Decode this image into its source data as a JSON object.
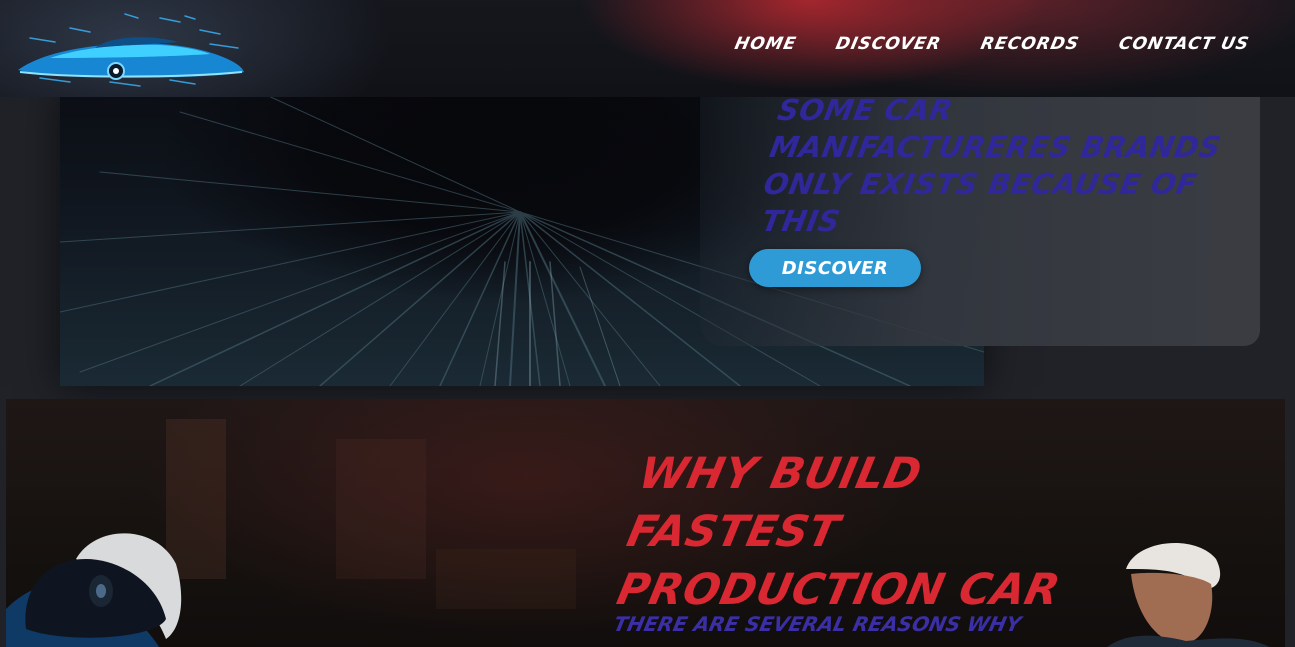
{
  "nav": {
    "items": [
      {
        "label": "HOME"
      },
      {
        "label": "DISCOVER"
      },
      {
        "label": "RECORDS"
      },
      {
        "label": "CONTACT US"
      }
    ]
  },
  "hero": {
    "title_lines": [
      "SOME CAR",
      "MANIFACTURERES BRANDS",
      "ONLY EXISTS BECAUSE OF",
      "THIS"
    ],
    "button_label": "DISCOVER"
  },
  "section2": {
    "title_lines": [
      "WHY BUILD",
      "FASTEST",
      "PRODUCTION CAR"
    ],
    "body": "THERE ARE SEVERAL REASONS WHY"
  },
  "colors": {
    "accent_blue": "#2e9ad6",
    "title_purple": "#30279a",
    "title_red": "#d92832"
  },
  "icons": {
    "logo": "car-logo-icon"
  }
}
